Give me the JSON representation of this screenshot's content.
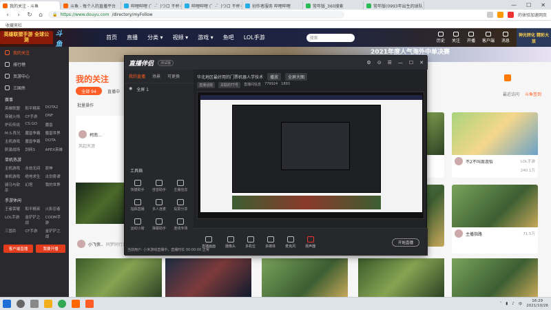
{
  "browser": {
    "tabs": [
      {
        "label": "我的关注 - 斗鱼",
        "active": true
      },
      {
        "label": "斗鱼 - 每个人的直播平台",
        "active": false
      },
      {
        "label": "哔哩哔哩 (゜-゜)つロ 干杯~",
        "active": false
      },
      {
        "label": "哔哩哔哩 (゜-゜)つロ 干杯~",
        "active": false
      },
      {
        "label": "创作者服务 哔哩哔哩",
        "active": false
      },
      {
        "label": "常年版_360搜索",
        "active": false
      },
      {
        "label": "常年版(0993年出生的球队",
        "active": false
      }
    ],
    "window_controls": [
      "—",
      "☐",
      "✕"
    ],
    "address": {
      "domain": "https://www.douyu.com",
      "path": "/directory/myFollow"
    },
    "promo_text": "的体验加速网页",
    "bookmark": "收藏夹栏"
  },
  "header": {
    "badge_text": "英雄联盟手游 全球公测",
    "brand": "斗鱼",
    "nav": [
      "首页",
      "直播",
      "分类 ▾",
      "视频 ▾",
      "游戏 ▾",
      "鱼吧",
      "LOL手游"
    ],
    "search_placeholder": "搜索",
    "right_items": [
      "历史",
      "关注",
      "开播",
      "客户端",
      "消息"
    ],
    "ad_right": "神光转化 精彩大放"
  },
  "sidebar": {
    "items": [
      {
        "label": "我的关注",
        "active": true
      },
      {
        "label": "排行榜",
        "active": false
      },
      {
        "label": "页游中心",
        "active": false
      },
      {
        "label": "三国杀",
        "active": false
      }
    ],
    "grid_a_head": "赛事",
    "grid_a": [
      "英雄联盟",
      "和平精英",
      "DOTA2",
      "穿越火线",
      "CF手游",
      "DNF",
      "炉石传说",
      "CS:GO",
      "魔兽",
      "M.S.阵兄",
      "魔兽争霸",
      "魔兽世界",
      "主机游戏",
      "魔兽争霸",
      "DOTA",
      "刺激战场",
      "剑网3",
      "APEX英雄"
    ],
    "grid_b_head": "单机热游",
    "grid_b": [
      "主机游戏",
      "永劫无间",
      "原神",
      "单机游戏",
      "绝地求生",
      "古剑奇谭",
      "骑马与砍杀",
      "幻塔",
      "我的世界"
    ],
    "grid_c_head": "手游休闲",
    "grid_c": [
      "王者荣耀",
      "和平精英",
      "火影忍者",
      "LOL手游",
      "金铲铲之战",
      "CODM手游",
      "三国杀",
      "CF手游",
      "金铲铲之战"
    ],
    "buttons": [
      "客户端直播",
      "我要开播"
    ]
  },
  "main": {
    "banner_text": "2021年度人气海外中单决赛",
    "title": "我的关注",
    "tab_all": "全部 94",
    "tab_live": "直播中",
    "batch_op": "批量操作",
    "recent": "最近访问",
    "sign": "斗鱼签到",
    "cards": [
      {
        "name": "不2不叫周淑怡",
        "hot": "LOL手游",
        "count": "240.1万"
      },
      {
        "name": "主播指路",
        "hot": "",
        "count": "71.5万"
      }
    ],
    "left_card": {
      "name": "柯南...",
      "sub": "风起天涯"
    },
    "left_card2": {
      "name": "小飞侠..",
      "sub": "同梦同行123"
    }
  },
  "app": {
    "logo": "直播伴侣",
    "version": "测试版",
    "tabs": [
      "我的直播",
      "场景",
      "可更换"
    ],
    "scene_label": "全屏 1",
    "toolbox_label": "工具箱",
    "tools": [
      "快捷助手",
      "佳音助手",
      "主播信息",
      "指挥直播",
      "多人连麦",
      "投屏分享",
      "运动小窗",
      "弹幕助手",
      "连线专场"
    ],
    "info_title": "华北地区最好用的门票机器人学技术",
    "info_pill1": "播放",
    "info_pill2": "全屏大图",
    "info_tags": [
      "直播话题",
      "关联的TT号",
      "直播间信息",
      "779924",
      "1893"
    ],
    "bottom": [
      "直播画面",
      "摄像头",
      "多机位",
      "多媒体",
      "麦克风",
      "扬声器"
    ],
    "start_live": "开始直播",
    "status": "当前用户: 小米游戏直播中，直播时长 00:00:00 正常",
    "title_icons": [
      "⚙",
      "⊙",
      "☰",
      "—",
      "☐",
      "✕"
    ]
  },
  "taskbar": {
    "time": "16:29",
    "date": "2021/10/26",
    "ime": "中"
  }
}
